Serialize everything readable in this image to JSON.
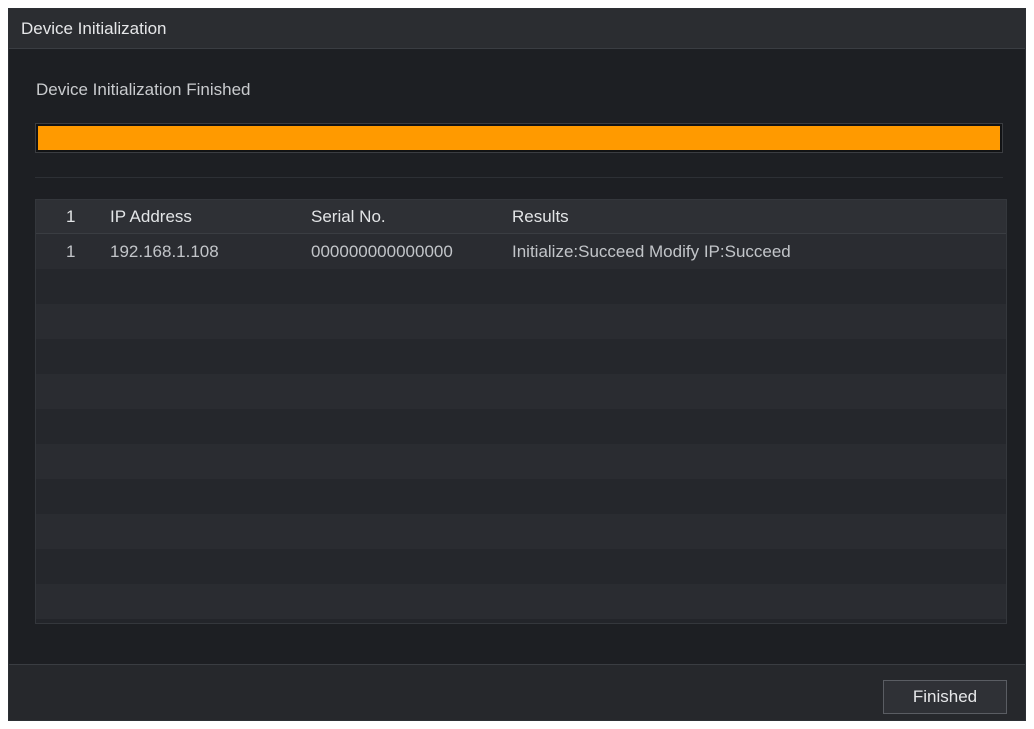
{
  "window": {
    "title": "Device Initialization"
  },
  "status": {
    "message": "Device Initialization Finished",
    "progress_percent": 100,
    "progress_color": "#ff9a00"
  },
  "table": {
    "columns": [
      "1",
      "IP Address",
      "Serial No.",
      "Results"
    ],
    "rows": [
      {
        "index": "1",
        "ip": "192.168.1.108",
        "serial": "000000000000000",
        "result": "Initialize:Succeed Modify IP:Succeed"
      }
    ],
    "empty_rows": 10
  },
  "footer": {
    "finish_label": "Finished"
  }
}
